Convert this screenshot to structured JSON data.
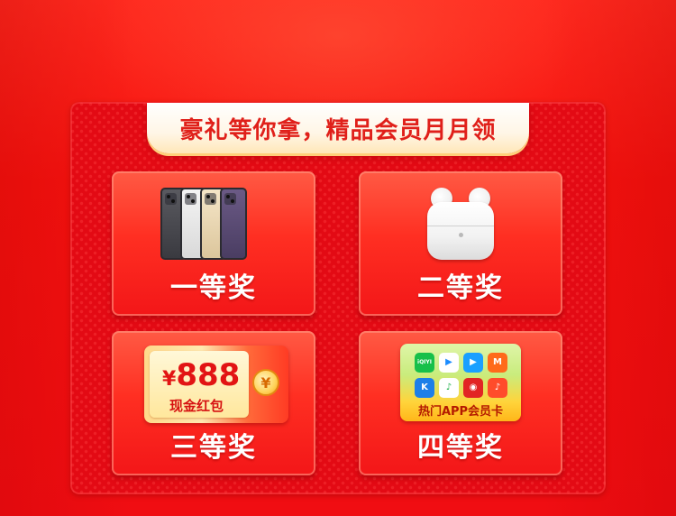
{
  "header": {
    "title": "豪礼等你拿，精品会员月月领"
  },
  "prizes": [
    {
      "label": "一等奖",
      "image": "iphone-set"
    },
    {
      "label": "二等奖",
      "image": "airpods-pro"
    },
    {
      "label": "三等奖",
      "image": "cash-red-packet",
      "amount": "888",
      "currency_symbol": "¥",
      "caption": "现金红包"
    },
    {
      "label": "四等奖",
      "image": "app-vip-card",
      "caption": "热门APP会员卡"
    }
  ],
  "colors": {
    "background": "#f5120f",
    "panel": "#e30a14",
    "title_text": "#e0201a",
    "card_label": "#ffffff"
  }
}
